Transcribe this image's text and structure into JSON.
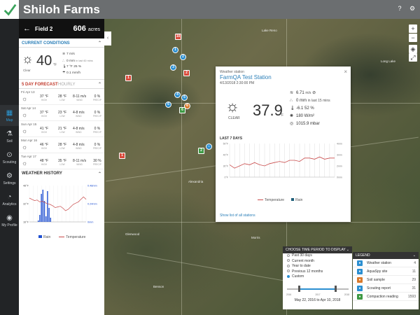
{
  "app": {
    "brand": "Shiloh Farms"
  },
  "nav": [
    {
      "label": "Map",
      "icon": "map-icon",
      "glyph": "▦"
    },
    {
      "label": "Soil",
      "icon": "flask-icon",
      "glyph": "⚗"
    },
    {
      "label": "Scouting",
      "icon": "binoculars-icon",
      "glyph": "⊙"
    },
    {
      "label": "Settings",
      "icon": "gear-icon",
      "glyph": "⚙"
    },
    {
      "label": "Analytics",
      "icon": "analytics-icon",
      "glyph": "◔"
    },
    {
      "label": "My Profile",
      "icon": "user-icon",
      "glyph": "◉"
    }
  ],
  "field": {
    "name": "Field 2",
    "acres": "606",
    "acres_unit": "acres"
  },
  "current": {
    "title": "CURRENT CONDITIONS",
    "condition": "Clear",
    "temp": "40",
    "unit": "°F",
    "wind": "7 m/s",
    "rain": "0 mm",
    "rain_note": "in last 60 mins",
    "humidity": "7 °F",
    "humidity_pct": "25 %",
    "precip": "0.1 mm/h"
  },
  "forecast": {
    "title": "5 DAY FORECAST",
    "hourly": "HOURLY",
    "days": [
      {
        "day": "Fri Apr 13",
        "hi": "37 °F",
        "lo": "28 °F",
        "wind": "8-11 m/s",
        "pop": "0 %"
      },
      {
        "day": "Sat Apr 14",
        "hi": "37 °F",
        "lo": "23 °F",
        "wind": "4-8 m/s",
        "pop": "0 %"
      },
      {
        "day": "Sun Apr 15",
        "hi": "41 °F",
        "lo": "21 °F",
        "wind": "4-8 m/s",
        "pop": "0 %"
      },
      {
        "day": "Mon Apr 16",
        "hi": "46 °F",
        "lo": "28 °F",
        "wind": "4-8 m/s",
        "pop": "0 %"
      },
      {
        "day": "Tue Apr 17",
        "hi": "48 °F",
        "lo": "35 °F",
        "wind": "8-11 m/s",
        "pop": "30 %"
      }
    ],
    "col_labels": {
      "hi": "HIGH",
      "lo": "LOW",
      "wind": "WIND",
      "pop": "PRECIP"
    }
  },
  "history": {
    "title": "WEATHER HISTORY",
    "y_left": [
      "48°F",
      "32°F",
      "16°F"
    ],
    "y_right": [
      "0.48mm",
      "0.24mm",
      "0mm"
    ],
    "legend_rain": "Rain",
    "legend_temp": "Temperature"
  },
  "popup": {
    "type": "Weather station",
    "name": "FarmQA Test Station",
    "date": "4/13/2018 2:30:00 PM",
    "condition": "CLEAR",
    "temp": "37.9",
    "unit": "°F",
    "wind": "6.71",
    "wind_unit": "m/s",
    "rain": "0 mm",
    "rain_note": "in last 15 mins",
    "dew": "-6.1",
    "humidity": "52 %",
    "solar": "180 W/m²",
    "pressure": "1015.9 mbar",
    "last7": "LAST 7 DAYS",
    "y_left": [
      "50°F",
      "40°F",
      "30°F",
      "0°F"
    ],
    "y_right": [
      "4mm",
      "3mm",
      "2mm",
      "0mm"
    ],
    "legend_temp": "Temperature",
    "legend_rain": "Rain",
    "link": "Show list of all stations"
  },
  "chart_data": {
    "type": "line",
    "title": "LAST 7 DAYS",
    "series": [
      {
        "name": "Temperature",
        "values": [
          31,
          28,
          30,
          32,
          31,
          33,
          31,
          30,
          32,
          33,
          34,
          33,
          35,
          35,
          34,
          37,
          37,
          36,
          38,
          36,
          37,
          37
        ]
      },
      {
        "name": "Rain",
        "values": [
          0,
          0,
          0,
          0,
          0,
          0,
          0,
          0,
          0,
          0,
          0,
          0,
          0,
          0,
          0,
          0,
          0,
          0,
          0,
          0,
          0,
          0
        ]
      }
    ],
    "ylim": [
      0,
      50
    ]
  },
  "timeperiod": {
    "title": "CHOOSE TIME PERIOD TO DISPLAY",
    "options": [
      "Past 30 days",
      "Current month",
      "Year to date",
      "Previous 12 months",
      "Custom"
    ],
    "selected": 4,
    "years": [
      "2016",
      "2017",
      "2018"
    ],
    "range": "May 22, 2016 to Apr 10, 2018"
  },
  "legend": {
    "title": "LEGEND",
    "items": [
      {
        "label": "Weather station",
        "count": "4",
        "color": "#2b8fd1",
        "icon": "weather-station-icon"
      },
      {
        "label": "AquaSpy site",
        "count": "11",
        "color": "#2b8fd1",
        "icon": "aquaspy-icon"
      },
      {
        "label": "Soil sample",
        "count": "29",
        "color": "#d97a2b",
        "icon": "soil-sample-icon"
      },
      {
        "label": "Scouting report",
        "count": "31",
        "color": "#2b8fd1",
        "icon": "scouting-icon"
      },
      {
        "label": "Compaction reading",
        "count": "1593",
        "color": "#3e9a44",
        "icon": "compaction-icon"
      }
    ]
  },
  "map_labels": [
    "Lake Reno",
    "Long Lake",
    "Alexandria",
    "Glenwood",
    "Morris",
    "Benson"
  ]
}
